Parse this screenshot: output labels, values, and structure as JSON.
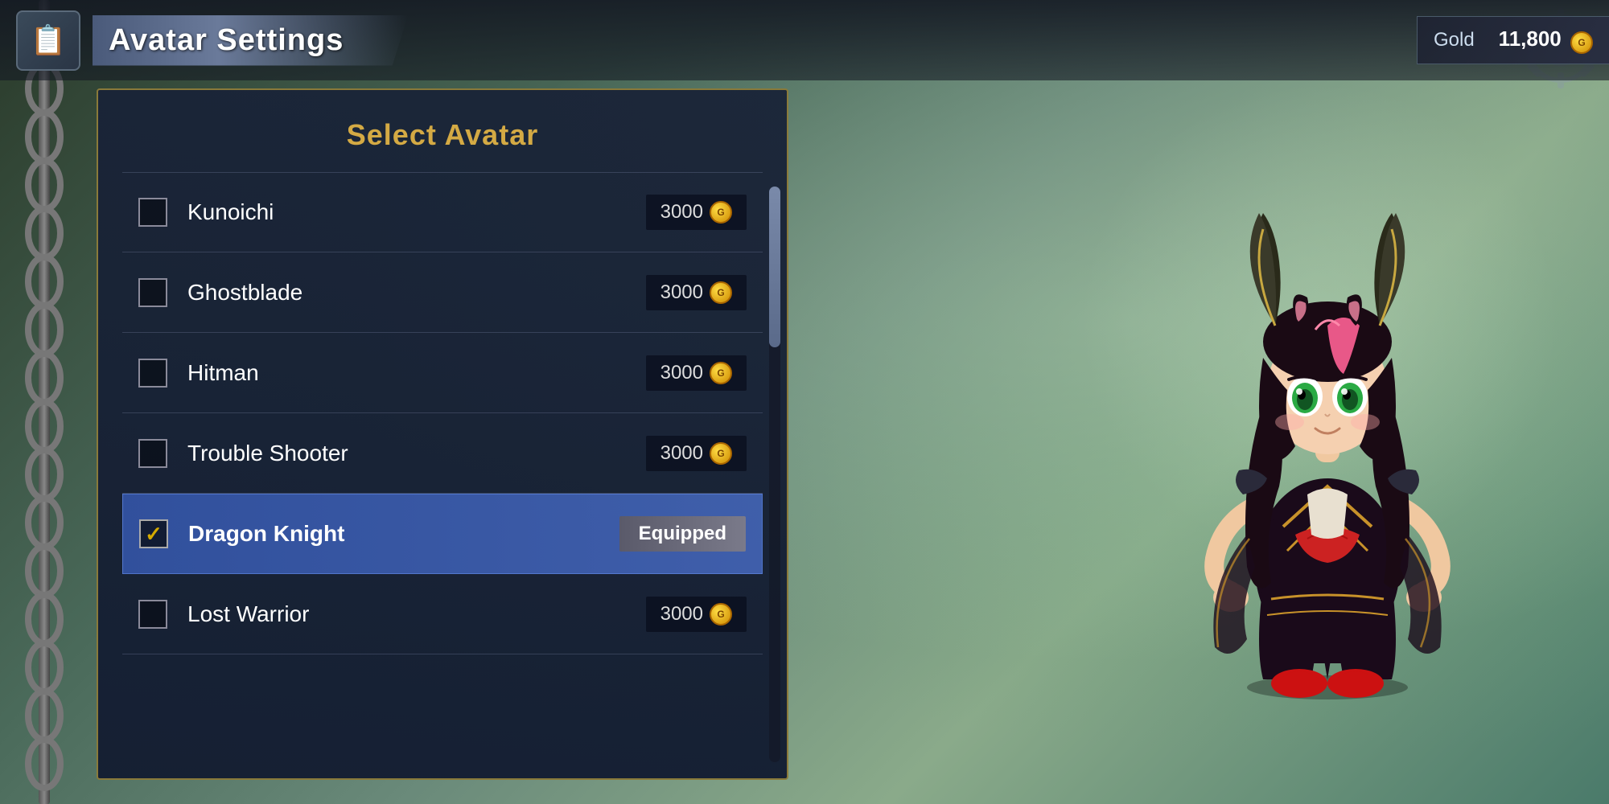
{
  "header": {
    "title": "Avatar Settings",
    "icon_label": "avatar-settings-icon"
  },
  "gold": {
    "label": "Gold",
    "amount": "11,800",
    "coin_symbol": "G"
  },
  "panel": {
    "title": "Select Avatar"
  },
  "avatars": [
    {
      "id": "kunoichi",
      "name": "Kunoichi",
      "price": "3000",
      "equipped": false,
      "selected": false
    },
    {
      "id": "ghostblade",
      "name": "Ghostblade",
      "price": "3000",
      "equipped": false,
      "selected": false
    },
    {
      "id": "hitman",
      "name": "Hitman",
      "price": "3000",
      "equipped": false,
      "selected": false
    },
    {
      "id": "trouble-shooter",
      "name": "Trouble Shooter",
      "price": "3000",
      "equipped": false,
      "selected": false
    },
    {
      "id": "dragon-knight",
      "name": "Dragon Knight",
      "price": "",
      "equipped": true,
      "selected": true
    },
    {
      "id": "lost-warrior",
      "name": "Lost Warrior",
      "price": "3000",
      "equipped": false,
      "selected": false
    }
  ],
  "labels": {
    "equipped": "Equipped",
    "coin": "G"
  },
  "colors": {
    "gold_text": "#d4aa44",
    "selected_bg": "rgba(60,100,200,0.7)",
    "panel_border": "#8a7a3a"
  }
}
